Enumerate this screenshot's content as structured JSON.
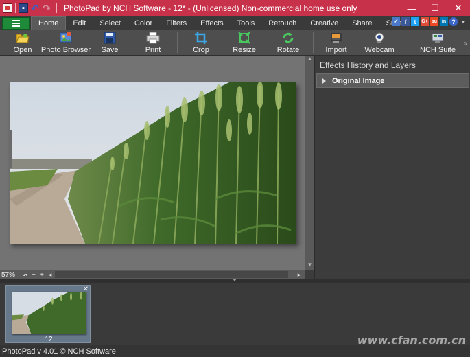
{
  "window": {
    "title": "PhotoPad by NCH Software - 12* - (Unlicensed) Non-commercial home use only",
    "minimize": "—",
    "maximize": "☐",
    "close": "✕"
  },
  "quick_access": [
    "save-icon",
    "undo-icon",
    "redo-icon"
  ],
  "tabs": [
    {
      "label": "Home",
      "active": true
    },
    {
      "label": "Edit"
    },
    {
      "label": "Select"
    },
    {
      "label": "Color"
    },
    {
      "label": "Filters"
    },
    {
      "label": "Effects"
    },
    {
      "label": "Tools"
    },
    {
      "label": "Retouch"
    },
    {
      "label": "Creative"
    },
    {
      "label": "Share"
    },
    {
      "label": "Suite"
    }
  ],
  "social": [
    {
      "icon": "thumbs-up-icon",
      "glyph": "👍",
      "color": "#4a78c8"
    },
    {
      "icon": "facebook-icon",
      "glyph": "f",
      "color": "#3b5998"
    },
    {
      "icon": "twitter-icon",
      "glyph": "t",
      "color": "#1da1f2"
    },
    {
      "icon": "google-plus-icon",
      "glyph": "G+",
      "color": "#dd4b39"
    },
    {
      "icon": "stumbleupon-icon",
      "glyph": "su",
      "color": "#eb4924"
    },
    {
      "icon": "linkedin-icon",
      "glyph": "in",
      "color": "#0077b5"
    },
    {
      "icon": "help-icon",
      "glyph": "?",
      "color": "#3a64c8"
    }
  ],
  "toolbar": {
    "open": "Open",
    "photo_browser": "Photo Browser",
    "save": "Save",
    "print": "Print",
    "crop": "Crop",
    "resize": "Resize",
    "rotate": "Rotate",
    "import": "Import",
    "webcam": "Webcam",
    "nch_suite": "NCH Suite",
    "more": "»"
  },
  "canvas": {
    "zoom": "57%"
  },
  "right_panel": {
    "title": "Effects History and Layers",
    "items": [
      {
        "label": "Original Image"
      }
    ]
  },
  "filmstrip": {
    "items": [
      {
        "label": "12"
      }
    ]
  },
  "status": {
    "text": "PhotoPad v 4.01 © NCH Software"
  },
  "watermark": "www.cfan.com.cn"
}
